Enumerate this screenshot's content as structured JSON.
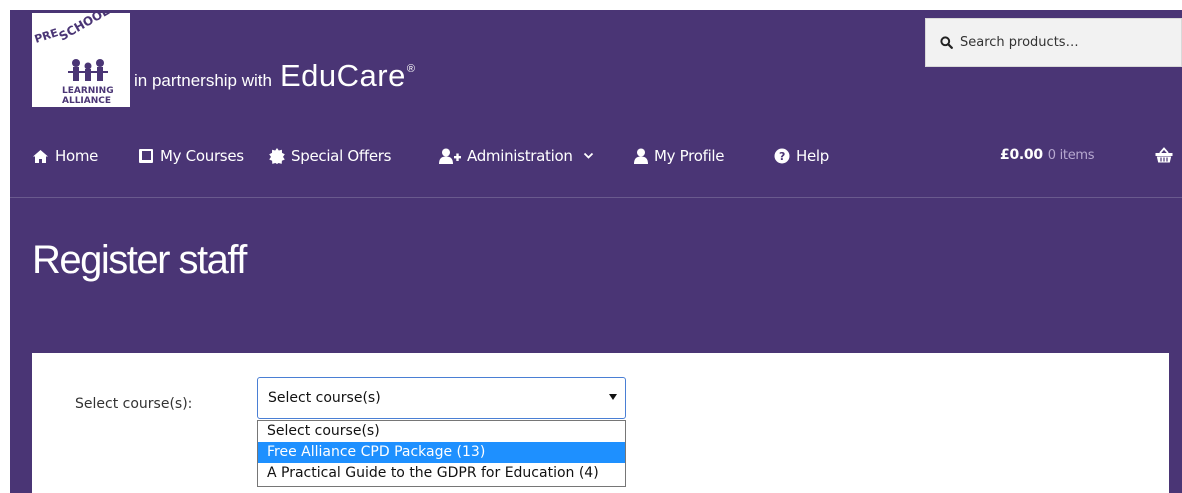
{
  "colors": {
    "brand_purple": "#4a3575",
    "highlight_blue": "#1e90ff",
    "select_border": "#4a7fd4"
  },
  "header": {
    "logo_text": [
      "PRE",
      "SCHOOL",
      "LEARNING",
      "ALLIANCE"
    ],
    "partner_text": "in partnership with",
    "partner_brand": "EduCare",
    "partner_mark": "®",
    "search": {
      "placeholder": "Search products…",
      "icon": "search-icon"
    }
  },
  "nav": {
    "items": [
      {
        "label": "Home",
        "icon": "home-icon"
      },
      {
        "label": "My Courses",
        "icon": "book-icon"
      },
      {
        "label": "Special Offers",
        "icon": "certificate-icon"
      },
      {
        "label": "Administration",
        "icon": "user-plus-icon",
        "has_dropdown": true
      },
      {
        "label": "My Profile",
        "icon": "user-icon"
      },
      {
        "label": "Help",
        "icon": "question-circle-icon"
      }
    ],
    "cart": {
      "price": "£0.00",
      "items": "0 items",
      "icon": "basket-icon"
    }
  },
  "page_title": "Register staff",
  "form": {
    "course_label": "Select course(s):",
    "course_select": {
      "value": "Select course(s)",
      "options": [
        "Select course(s)",
        "Free Alliance CPD Package (13)",
        "A Practical Guide to the GDPR for Education (4)"
      ],
      "highlighted_option": "Free Alliance CPD Package (13)"
    }
  }
}
